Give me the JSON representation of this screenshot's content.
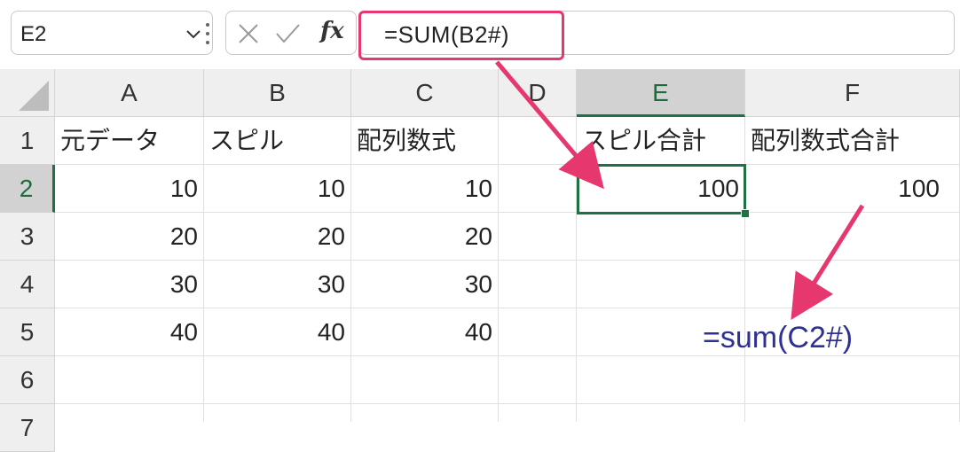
{
  "name_box": {
    "value": "E2"
  },
  "formula_bar": {
    "formula": "=SUM(B2#)",
    "fx_label": "fx"
  },
  "columns": [
    "A",
    "B",
    "C",
    "D",
    "E",
    "F"
  ],
  "rows": [
    "1",
    "2",
    "3",
    "4",
    "5",
    "6",
    "7"
  ],
  "cells": {
    "A1": "元データ",
    "B1": "スピル",
    "C1": "配列数式",
    "E1": "スピル合計",
    "F1": "配列数式合計",
    "A2": "10",
    "B2": "10",
    "C2": "10",
    "E2": "100",
    "F2": "100",
    "A3": "20",
    "B3": "20",
    "C3": "20",
    "A4": "30",
    "B4": "30",
    "C4": "30",
    "A5": "40",
    "B5": "40",
    "C5": "40"
  },
  "annotation": {
    "text": "=sum(C2#)"
  },
  "colors": {
    "highlight": "#e6386e",
    "selection": "#1e7145",
    "annotation": "#2e3192"
  }
}
